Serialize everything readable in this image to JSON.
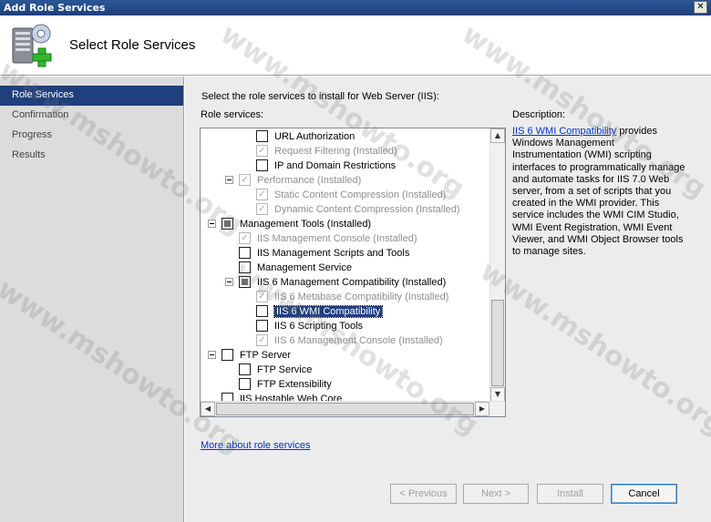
{
  "window": {
    "title": "Add Role Services",
    "close_glyph": "✕"
  },
  "header": {
    "title": "Select Role Services",
    "icon": "server-roles-add-icon"
  },
  "sidebar": {
    "items": [
      {
        "label": "Role Services",
        "active": true
      },
      {
        "label": "Confirmation",
        "active": false
      },
      {
        "label": "Progress",
        "active": false
      },
      {
        "label": "Results",
        "active": false
      }
    ]
  },
  "main": {
    "intro": "Select the role services to install for Web Server (IIS):",
    "role_services_label": "Role services:",
    "tree": [
      {
        "label": "URL Authorization",
        "state": "unchecked",
        "disabled": false
      },
      {
        "label": "Request Filtering  (Installed)",
        "state": "checked",
        "disabled": true
      },
      {
        "label": "IP and Domain Restrictions",
        "state": "unchecked",
        "disabled": false
      },
      {
        "label": "Performance  (Installed)",
        "state": "checked",
        "disabled": true
      },
      {
        "label": "Static Content Compression  (Installed)",
        "state": "checked",
        "disabled": true
      },
      {
        "label": "Dynamic Content Compression  (Installed)",
        "state": "checked",
        "disabled": true
      },
      {
        "label": "Management Tools  (Installed)",
        "state": "partial",
        "disabled": false
      },
      {
        "label": "IIS Management Console  (Installed)",
        "state": "checked",
        "disabled": true
      },
      {
        "label": "IIS Management Scripts and Tools",
        "state": "unchecked",
        "disabled": false
      },
      {
        "label": "Management Service",
        "state": "unchecked",
        "disabled": false
      },
      {
        "label": "IIS 6 Management Compatibility  (Installed)",
        "state": "partial",
        "disabled": false
      },
      {
        "label": "IIS 6 Metabase Compatibility  (Installed)",
        "state": "checked",
        "disabled": true
      },
      {
        "label": "IIS 6 WMI Compatibility",
        "state": "unchecked",
        "disabled": false,
        "selected": true
      },
      {
        "label": "IIS 6 Scripting Tools",
        "state": "unchecked",
        "disabled": false
      },
      {
        "label": "IIS 6 Management Console  (Installed)",
        "state": "checked",
        "disabled": true
      },
      {
        "label": "FTP Server",
        "state": "unchecked",
        "disabled": false
      },
      {
        "label": "FTP Service",
        "state": "unchecked",
        "disabled": false
      },
      {
        "label": "FTP Extensibility",
        "state": "unchecked",
        "disabled": false
      },
      {
        "label": "IIS Hostable Web Core",
        "state": "unchecked",
        "disabled": false
      }
    ],
    "more_link": "More about role services",
    "description_title": "Description:",
    "description_link": "IIS 6 WMI Compatibility",
    "description_body": " provides Windows Management Instrumentation (WMI) scripting interfaces to programmatically manage and automate tasks for IIS 7.0 Web server, from a set of scripts that you created in the WMI provider. This service includes the WMI CIM Studio, WMI Event Registration, WMI Event Viewer, and WMI Object Browser tools to manage sites."
  },
  "buttons": {
    "previous": "< Previous",
    "next": "Next >",
    "install": "Install",
    "cancel": "Cancel"
  },
  "watermark": "www.mshowto.org",
  "check_glyph": "✓"
}
